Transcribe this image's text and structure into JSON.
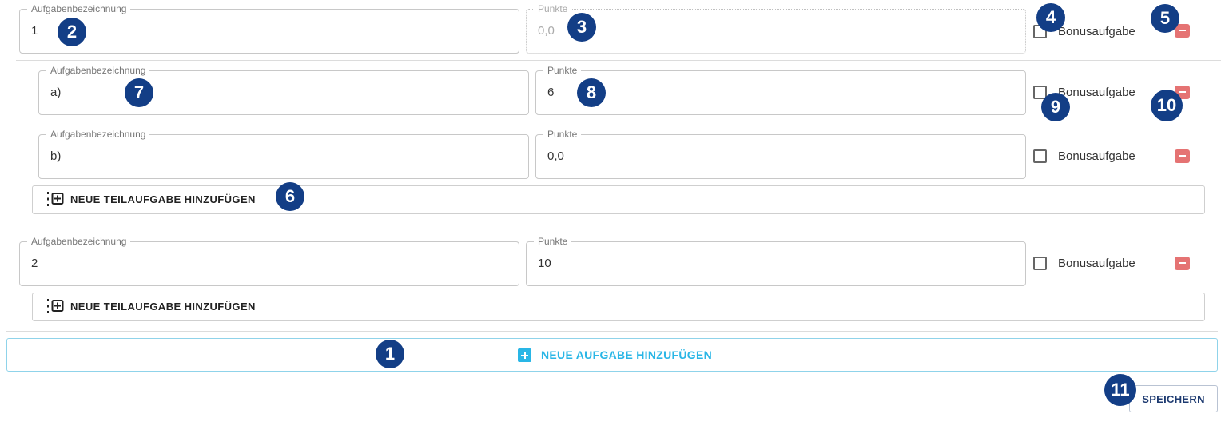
{
  "labels": {
    "bezeichnung": "Aufgabenbezeichnung",
    "punkte": "Punkte",
    "bonus": "Bonusaufgabe"
  },
  "task1": {
    "bezeichnung": "1",
    "punkte": "0,0",
    "subtasks": [
      {
        "bezeichnung": "a)",
        "punkte": "6"
      },
      {
        "bezeichnung": "b)",
        "punkte": "0,0"
      }
    ],
    "add_subtask_label": "NEUE TEILAUFGABE HINZUFÜGEN"
  },
  "task2": {
    "bezeichnung": "2",
    "punkte": "10",
    "add_subtask_label": "NEUE TEILAUFGABE HINZUFÜGEN"
  },
  "add_task_label": "NEUE AUFGABE HINZUFÜGEN",
  "save_label": "SPEICHERN",
  "annotations": [
    "1",
    "2",
    "3",
    "4",
    "5",
    "6",
    "7",
    "8",
    "9",
    "10",
    "11"
  ],
  "colors": {
    "accent": "#29b6e6",
    "remove": "#e57373",
    "badge": "#133e86",
    "save_text": "#1d3a70"
  }
}
